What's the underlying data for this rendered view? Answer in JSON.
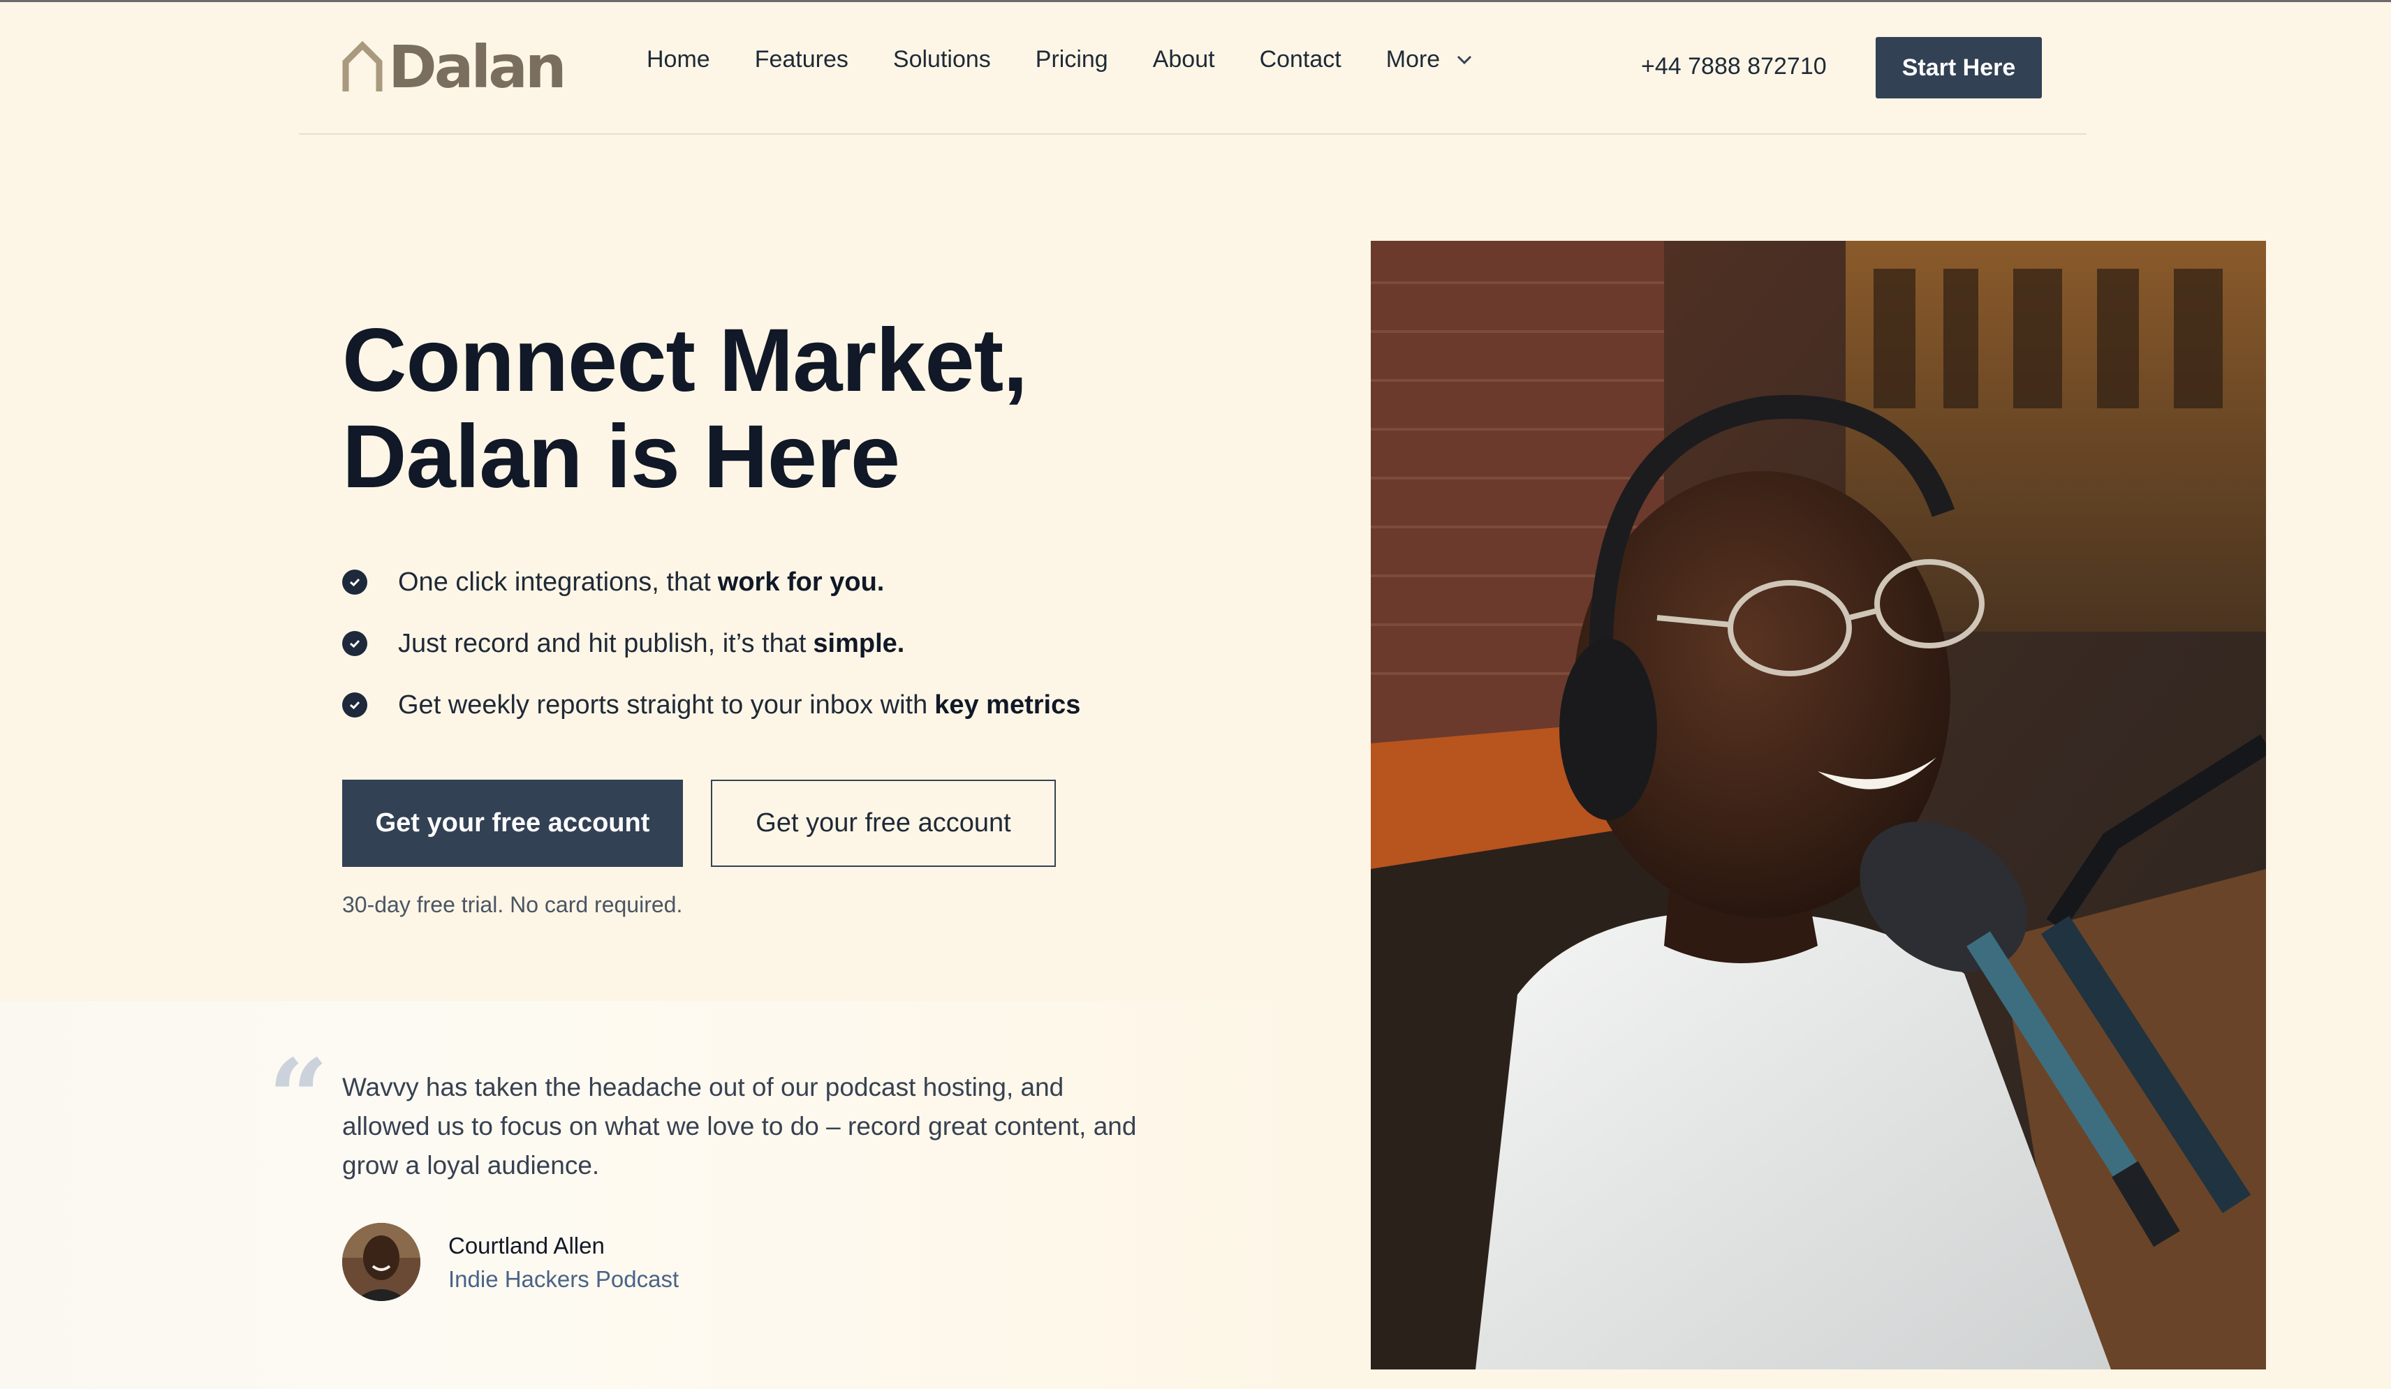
{
  "brand": {
    "name": "Dalan",
    "logo_color": "#7a6f5e",
    "logo_icon": "house-outline-icon"
  },
  "nav": {
    "items": [
      "Home",
      "Features",
      "Solutions",
      "Pricing",
      "About",
      "Contact"
    ],
    "more_label": "More",
    "phone": "+44 7888 872710",
    "cta_label": "Start Here"
  },
  "hero": {
    "headline_line1": "Connect Market,",
    "headline_line2": "Dalan is Here",
    "features": [
      {
        "text": "One click integrations, that",
        "emphasis": "work for you."
      },
      {
        "text": "Just record and hit publish, it’s that",
        "emphasis": "simple."
      },
      {
        "text": "Get weekly reports straight to your inbox with",
        "emphasis": "key metrics"
      }
    ],
    "primary_cta": "Get your free account",
    "secondary_cta": "Get your free account",
    "trial_note": "30-day free trial. No card required."
  },
  "testimonial": {
    "quote": "Wavvy has taken the headache out of our podcast hosting, and allowed us to focus on what we love to do – record great content, and grow a loyal audience.",
    "author_name": "Courtland Allen",
    "author_role": "Indie Hackers Podcast"
  },
  "colors": {
    "background": "#fdf6e6",
    "primary_button": "#334155",
    "heading": "#111827",
    "author_role": "#4a6387"
  }
}
